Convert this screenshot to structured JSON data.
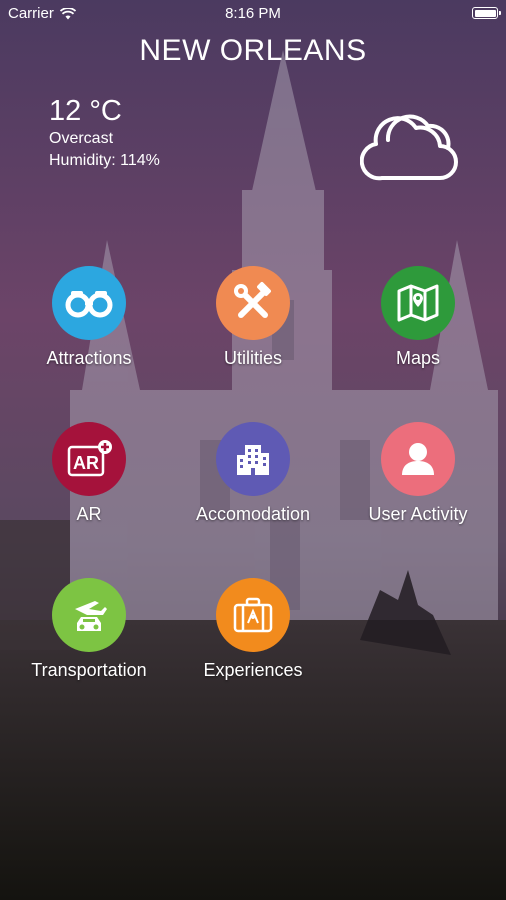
{
  "status_bar": {
    "carrier": "Carrier",
    "time": "8:16 PM"
  },
  "header": {
    "title": "NEW ORLEANS"
  },
  "weather": {
    "temperature": "12 °C",
    "condition": "Overcast",
    "humidity": "Humidity: 114%",
    "icon": "cloud-icon"
  },
  "menu": [
    {
      "label": "Attractions",
      "icon": "binoculars-icon",
      "color": "#2CA7E0"
    },
    {
      "label": "Utilities",
      "icon": "tools-icon",
      "color": "#F08A52"
    },
    {
      "label": "Maps",
      "icon": "map-icon",
      "color": "#2E9A3B"
    },
    {
      "label": "AR",
      "icon": "ar-icon",
      "color": "#A5123B"
    },
    {
      "label": "Accomodation",
      "icon": "building-icon",
      "color": "#5F5AB4"
    },
    {
      "label": "User Activity",
      "icon": "user-icon",
      "color": "#EC6E7C"
    },
    {
      "label": "Transportation",
      "icon": "plane-car-icon",
      "color": "#7DC443"
    },
    {
      "label": "Experiences",
      "icon": "suitcase-icon",
      "color": "#F28B1D"
    }
  ]
}
